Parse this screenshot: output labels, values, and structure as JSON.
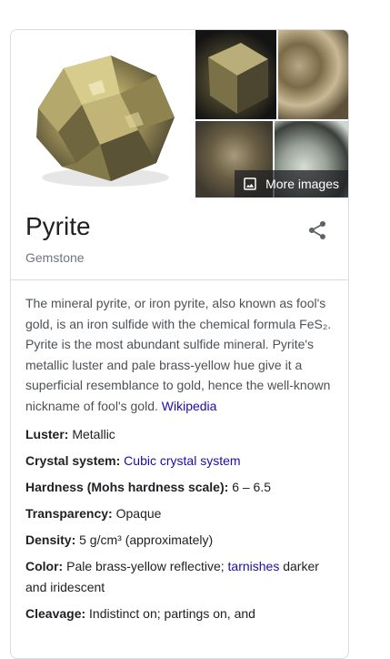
{
  "entity": {
    "title": "Pyrite",
    "subtitle": "Gemstone"
  },
  "images": {
    "more_label": "More images"
  },
  "description": {
    "text": "The mineral pyrite, or iron pyrite, also known as fool's gold, is an iron sulfide with the chemical formula FeS₂. Pyrite is the most abundant sulfide mineral. Pyrite's metallic luster and pale brass-yellow hue give it a superficial resemblance to gold, hence the well-known nickname of fool's gold.",
    "source_link": "Wikipedia"
  },
  "facts": {
    "luster": {
      "label": "Luster:",
      "value": "Metallic"
    },
    "crystal_system": {
      "label": "Crystal system:",
      "value": "Cubic crystal system"
    },
    "hardness": {
      "label": "Hardness (Mohs hardness scale):",
      "value": "6 – 6.5"
    },
    "transparency": {
      "label": "Transparency:",
      "value": "Opaque"
    },
    "density": {
      "label": "Density:",
      "value": "5 g/cm³ (approximately)"
    },
    "color": {
      "label": "Color:",
      "value_before": "Pale brass-yellow reflective;",
      "link": "tarnishes",
      "value_after": "darker and iridescent"
    },
    "cleavage": {
      "label": "Cleavage:",
      "value": "Indistinct on; partings on, and"
    }
  },
  "colors": {
    "link": "#1a0dab",
    "text": "#202124",
    "secondary": "#70757a",
    "body": "#4d5156"
  }
}
